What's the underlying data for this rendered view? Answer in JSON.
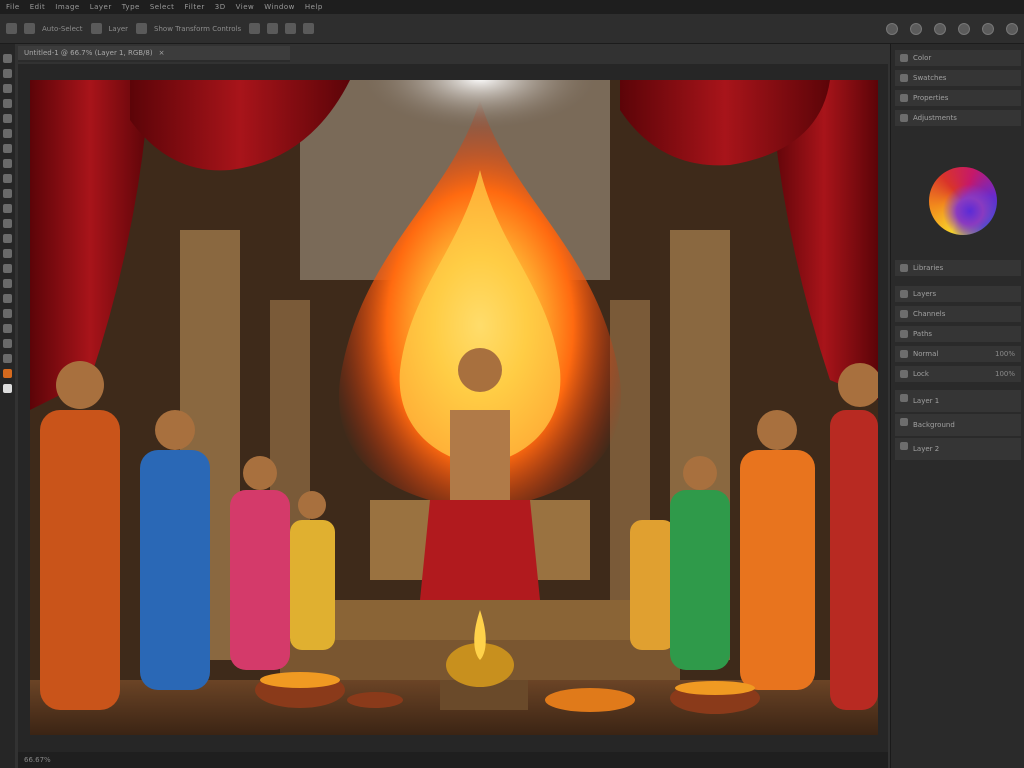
{
  "window": {
    "menu_items": [
      "File",
      "Edit",
      "Image",
      "Layer",
      "Type",
      "Select",
      "Filter",
      "3D",
      "View",
      "Window",
      "Help"
    ],
    "options_labels": [
      "Auto-Select",
      "Layer",
      "Show Transform Controls"
    ],
    "doc_tab": "Untitled-1 @ 66.7% (Layer 1, RGB/8)",
    "status": "66.67%"
  },
  "panels": {
    "tabs": [
      "Color",
      "Swatches"
    ],
    "rows": [
      {
        "label": "Properties",
        "value": ""
      },
      {
        "label": "Adjustments",
        "value": ""
      },
      {
        "label": "Libraries",
        "value": ""
      },
      {
        "label": "Layers",
        "value": ""
      },
      {
        "label": "Channels",
        "value": ""
      },
      {
        "label": "Paths",
        "value": ""
      },
      {
        "label": "Normal",
        "value": "100%"
      },
      {
        "label": "Lock",
        "value": "100%"
      },
      {
        "label": "Layer 1",
        "value": ""
      },
      {
        "label": "Background",
        "value": ""
      },
      {
        "label": "Layer 2",
        "value": ""
      }
    ]
  },
  "colors": {
    "panel_bg": "#2a2a2a",
    "canvas_bg": "#262626",
    "flame": "#ff8a1a",
    "curtain": "#8b0f14",
    "gold": "#d4a133"
  },
  "artwork": {
    "description_icon": "image-canvas-icon"
  }
}
